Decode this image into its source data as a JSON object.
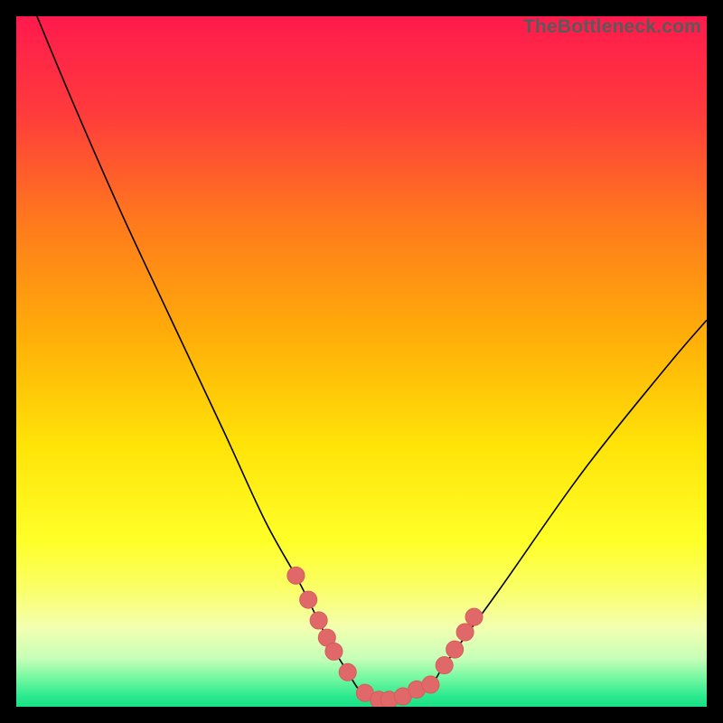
{
  "watermark": "TheBottleneck.com",
  "colors": {
    "frame": "#000000",
    "curve": "#000000",
    "marker_fill": "#e06868",
    "marker_stroke": "#d85a5a",
    "gradient_stops": [
      {
        "offset": 0.0,
        "color": "#ff1a4d"
      },
      {
        "offset": 0.14,
        "color": "#ff3b3c"
      },
      {
        "offset": 0.3,
        "color": "#ff7a1c"
      },
      {
        "offset": 0.47,
        "color": "#ffb008"
      },
      {
        "offset": 0.62,
        "color": "#ffe308"
      },
      {
        "offset": 0.76,
        "color": "#ffff28"
      },
      {
        "offset": 0.83,
        "color": "#faff68"
      },
      {
        "offset": 0.885,
        "color": "#f3ffb0"
      },
      {
        "offset": 0.93,
        "color": "#c7ffb8"
      },
      {
        "offset": 0.96,
        "color": "#70f7a0"
      },
      {
        "offset": 0.985,
        "color": "#2be98e"
      },
      {
        "offset": 1.0,
        "color": "#19e086"
      }
    ]
  },
  "chart_data": {
    "type": "line",
    "title": "",
    "xlabel": "",
    "ylabel": "",
    "xlim": [
      0,
      100
    ],
    "ylim": [
      0,
      100
    ],
    "grid": false,
    "series": [
      {
        "name": "bottleneck-curve",
        "x": [
          3,
          8,
          15,
          22,
          30,
          36,
          41,
          45,
          48,
          50,
          52,
          55,
          57,
          60,
          62,
          70,
          82,
          94,
          100
        ],
        "y": [
          100,
          88,
          72,
          57,
          40,
          27,
          18,
          10,
          5,
          2,
          1,
          1,
          2,
          3,
          6,
          17,
          34,
          49,
          56
        ]
      }
    ],
    "markers": {
      "name": "highlight-points",
      "x": [
        40.5,
        42.3,
        43.8,
        45.0,
        46.0,
        48.0,
        50.5,
        52.5,
        54.0,
        56.0,
        58.0,
        60.0,
        62.0,
        63.5,
        65.0,
        66.3
      ],
      "y": [
        19.0,
        15.5,
        12.5,
        10.0,
        8.0,
        5.0,
        2.0,
        1.0,
        1.0,
        1.5,
        2.5,
        3.2,
        6.0,
        8.3,
        10.8,
        13.0
      ]
    }
  }
}
